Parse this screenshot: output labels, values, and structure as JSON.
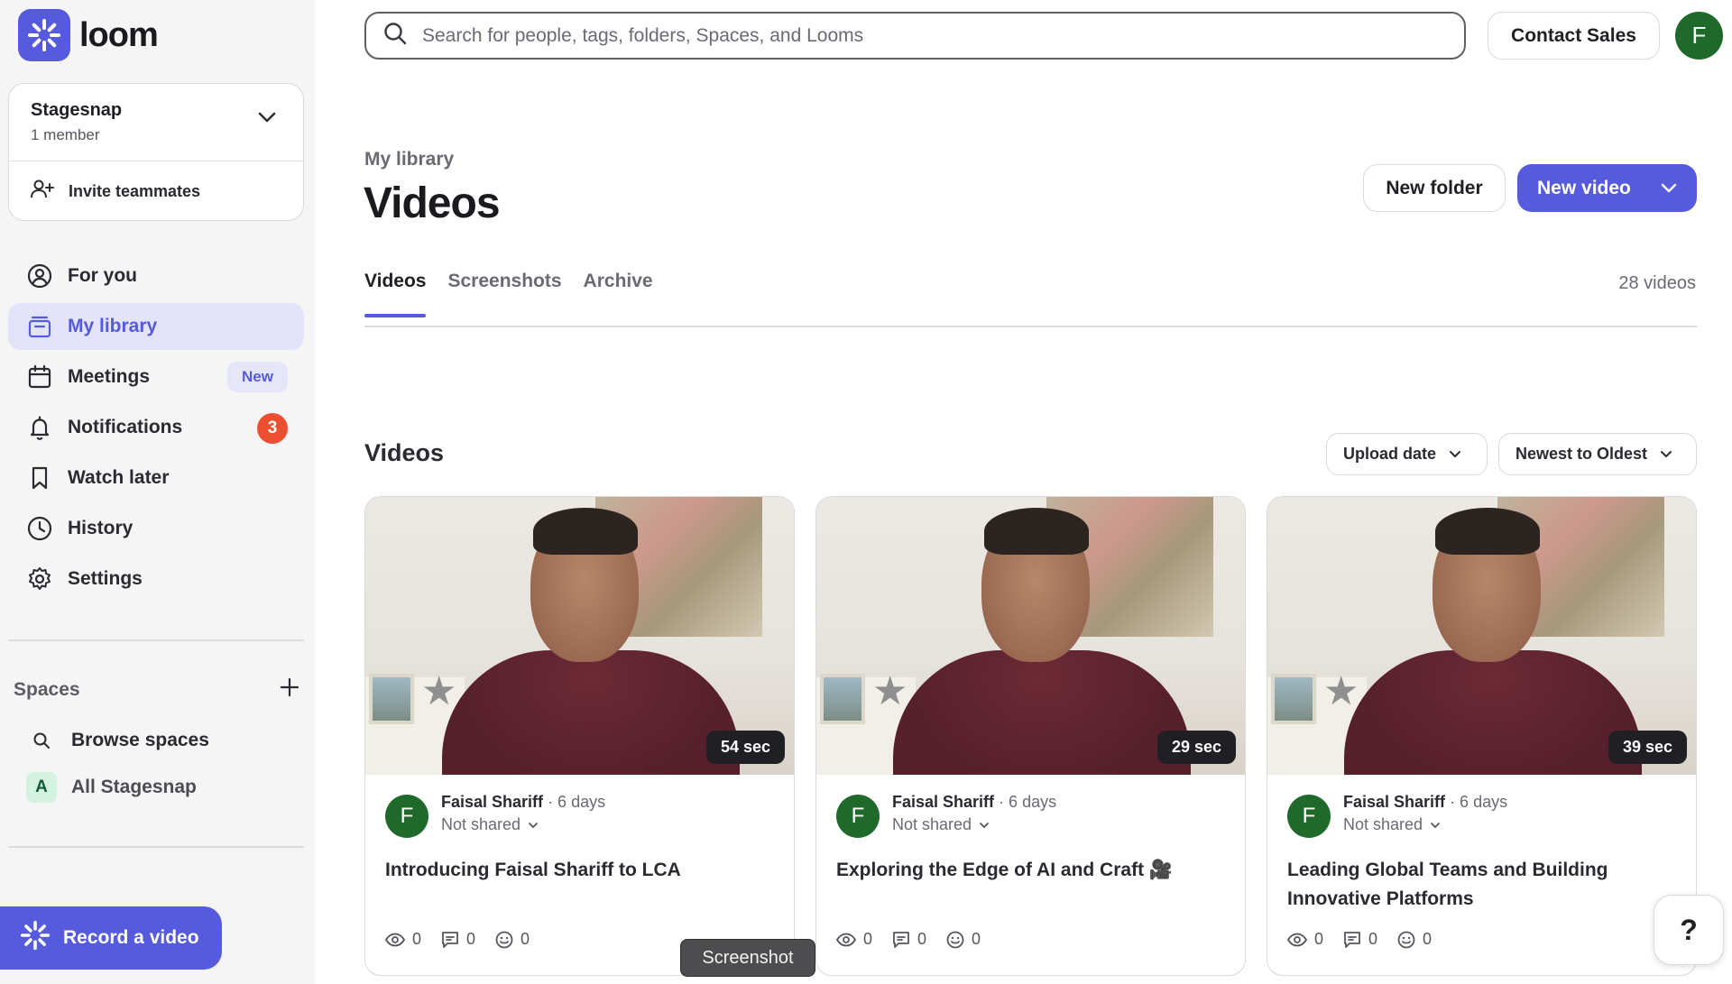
{
  "brand": {
    "name": "loom",
    "accent": "#565add"
  },
  "search": {
    "placeholder": "Search for people, tags, folders, Spaces, and Looms"
  },
  "header": {
    "contact_sales": "Contact Sales",
    "user_initial": "F"
  },
  "workspace": {
    "name": "Stagesnap",
    "members": "1 member",
    "invite": "Invite teammates"
  },
  "nav": [
    {
      "label": "For you",
      "icon": "user-circle-icon"
    },
    {
      "label": "My library",
      "icon": "library-icon",
      "active": true
    },
    {
      "label": "Meetings",
      "icon": "calendar-icon",
      "badge": "New"
    },
    {
      "label": "Notifications",
      "icon": "bell-icon",
      "count": "3"
    },
    {
      "label": "Watch later",
      "icon": "bookmark-icon"
    },
    {
      "label": "History",
      "icon": "clock-icon"
    },
    {
      "label": "Settings",
      "icon": "gear-icon"
    }
  ],
  "spaces": {
    "heading": "Spaces",
    "browse": "Browse spaces",
    "all": "All Stagesnap",
    "all_initial": "A"
  },
  "record": {
    "label": "Record a video"
  },
  "main": {
    "breadcrumb": "My library",
    "title": "Videos",
    "new_folder": "New folder",
    "new_video": "New video",
    "tabs": [
      "Videos",
      "Screenshots",
      "Archive"
    ],
    "count": "28 videos",
    "section_title": "Videos",
    "filter_date": "Upload date",
    "filter_sort": "Newest to Oldest"
  },
  "videos": [
    {
      "duration": "54 sec",
      "author": "Faisal Shariff",
      "age": "· 6 days",
      "sharing": "Not shared",
      "title": "Introducing Faisal Shariff to LCA",
      "views": "0",
      "comments": "0",
      "reactions": "0"
    },
    {
      "duration": "29 sec",
      "author": "Faisal Shariff",
      "age": "· 6 days",
      "sharing": "Not shared",
      "title": "Exploring the Edge of AI and Craft 🎥",
      "views": "0",
      "comments": "0",
      "reactions": "0"
    },
    {
      "duration": "39 sec",
      "author": "Faisal Shariff",
      "age": "· 6 days",
      "sharing": "Not shared",
      "title": "Leading Global Teams and Building Innovative Platforms",
      "views": "0",
      "comments": "0",
      "reactions": "0"
    }
  ],
  "tooltip": "Screenshot",
  "help": "?"
}
